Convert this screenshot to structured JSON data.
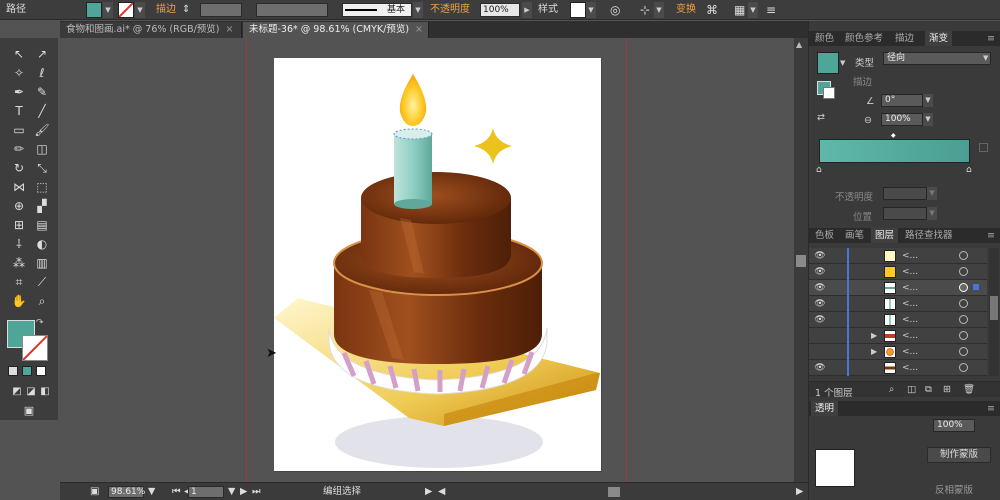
{
  "control_bar": {
    "object_type": "路径",
    "stroke_label": "描边",
    "brush_label": "基本",
    "opacity_label": "不透明度",
    "opacity_value": "100%",
    "style_label": "样式",
    "transform_label": "变换"
  },
  "tabs": [
    {
      "label": "食物和图画.ai* @ 76% (RGB/预览)"
    },
    {
      "label": "未标题-36* @ 98.61% (CMYK/预览)"
    }
  ],
  "status_bar": {
    "zoom": "98.61%",
    "artboard": "1",
    "tool_status": "编组选择"
  },
  "right_panel": {
    "top_tabs": [
      "颜色",
      "颜色参考",
      "描边",
      "渐变"
    ],
    "gradient": {
      "type_label": "类型",
      "type_value": "径向",
      "stroke_label": "描边",
      "angle_value": "0°",
      "aspect_value": "100%",
      "opacity_label": "不透明度",
      "location_label": "位置",
      "gradient_start": "#5fb8aa",
      "gradient_end": "#4a9e92"
    },
    "layer_tabs": [
      "色板",
      "画笔",
      "图层",
      "路径查找器"
    ],
    "layer_name": "<...",
    "layer_count": "1 个图层",
    "bottom_tabs": [
      "透明"
    ],
    "bottom_opacity": "100%",
    "bottom_buttons": [
      "制作蒙版",
      "反相蒙版"
    ]
  },
  "colors": {
    "fill_swatch": "#4fa597",
    "accent_orange": "#f0a045",
    "layer_color": "#4a74d8"
  }
}
